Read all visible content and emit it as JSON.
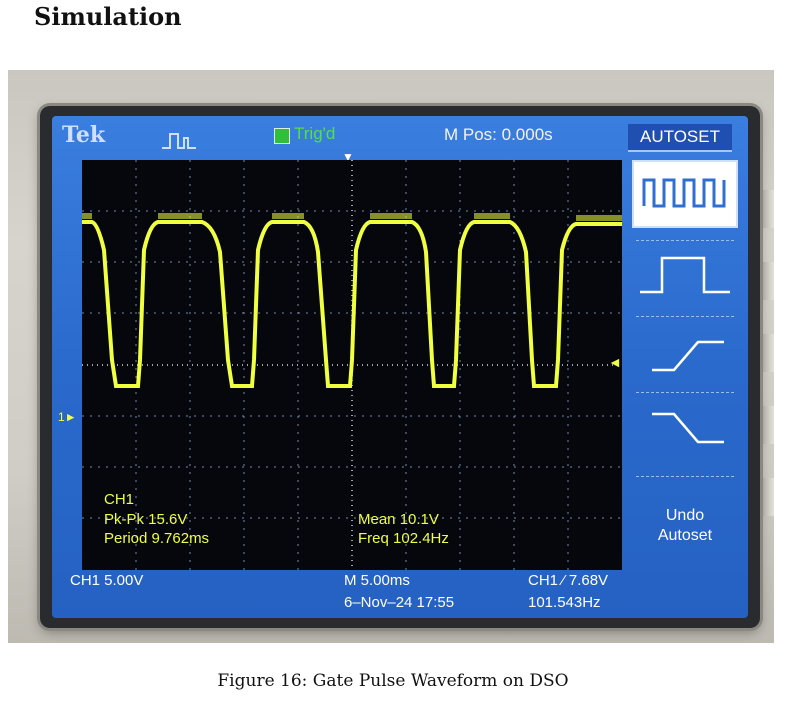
{
  "section_title": "Simulation",
  "caption": "Figure 16: Gate Pulse Waveform on DSO",
  "scope": {
    "brand": "Tek",
    "trigger_status": "Trig'd",
    "trigger_indicator": "T",
    "m_pos": "M Pos: 0.000s",
    "autoset_label": "AUTOSET",
    "channel_marker": "1",
    "measurements": {
      "ch_label": "CH1",
      "pk_pk": "Pk-Pk 15.6V",
      "period": "Period 9.762ms",
      "mean": "Mean 10.1V",
      "freq": "Freq 102.4Hz"
    },
    "menu": {
      "undo_line1": "Undo",
      "undo_line2": "Autoset"
    },
    "status": {
      "ch1_scale": "CH1  5.00V",
      "timebase": "M 5.00ms",
      "trigger_setting": "CH1 ⁄ 7.68V",
      "date_time": "6–Nov–24 17:55",
      "trigger_freq": "101.543Hz"
    },
    "colors": {
      "screen_blue": "#2f6fd0",
      "trace": "#f0ff40",
      "graticule_bg": "#05070c",
      "trig_green": "#4fe04a"
    }
  }
}
